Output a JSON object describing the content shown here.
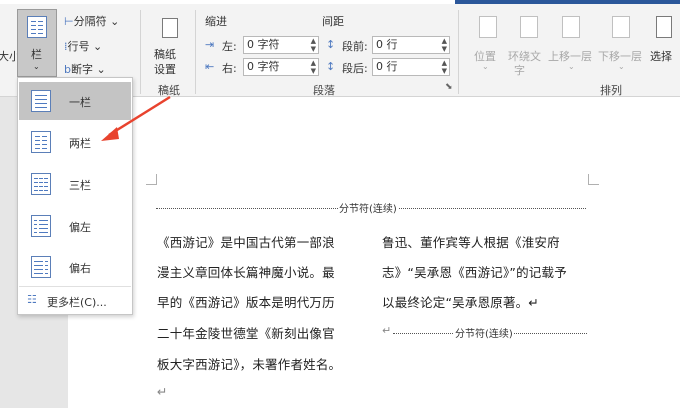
{
  "ribbon": {
    "size_cut": "大小",
    "columns_button": "栏",
    "breaks": "分隔符",
    "line_numbers": "行号",
    "hyphenation": "断字",
    "manuscript_line1": "稿纸",
    "manuscript_line2": "设置",
    "manuscript_group": "稿纸",
    "indent_label": "缩进",
    "spacing_label": "间距",
    "indent_left_label": "左:",
    "indent_left_value": "0 字符",
    "indent_right_label": "右:",
    "indent_right_value": "0 字符",
    "space_before_label": "段前:",
    "space_before_value": "0 行",
    "space_after_label": "段后:",
    "space_after_value": "0 行",
    "paragraph_group": "段落",
    "position": "位置",
    "wrap_text_line1": "环绕文",
    "wrap_text_line2": "字",
    "bring_forward": "上移一层",
    "send_backward": "下移一层",
    "selection_pane": "选择",
    "arrange_group": "排列"
  },
  "columns_menu": {
    "items": [
      {
        "label": "一栏",
        "icon": "one-column-icon",
        "selected": true
      },
      {
        "label": "两栏",
        "icon": "two-columns-icon",
        "selected": false
      },
      {
        "label": "三栏",
        "icon": "three-columns-icon",
        "selected": false
      },
      {
        "label": "偏左",
        "icon": "left-column-icon",
        "selected": false
      },
      {
        "label": "偏右",
        "icon": "right-column-icon",
        "selected": false
      }
    ],
    "more": "更多栏(C)..."
  },
  "document": {
    "section_break_top": "分节符(连续)",
    "section_break_inline": "分节符(连续)",
    "left_column": [
      "《西游记》是中国古代第一部浪",
      "漫主义章回体长篇神魔小说。最",
      "早的《西游记》版本是明代万历",
      "二十年金陵世德堂《新刻出像官",
      "板大字西游记》，未署作者姓名。"
    ],
    "right_column": [
      "鲁迅、董作宾等人根据《淮安府",
      "志》“吴承恩《西游记》”的记载予",
      "以最终论定“吴承恩原著。↵"
    ],
    "para_mark": "↵"
  },
  "colors": {
    "accent": "#2b579a",
    "arrow": "#e8432e"
  }
}
